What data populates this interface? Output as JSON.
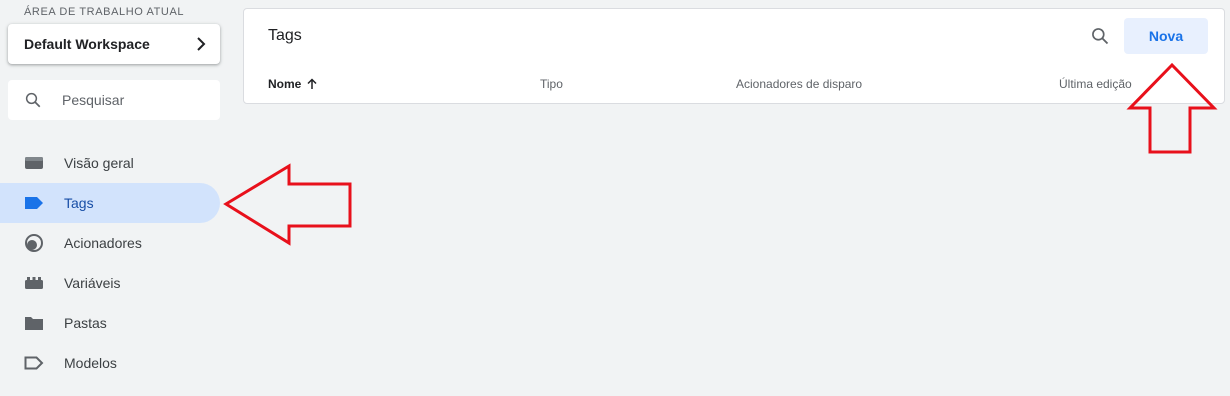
{
  "workspace": {
    "section_label": "ÁREA DE TRABALHO ATUAL",
    "name": "Default Workspace"
  },
  "sidebar": {
    "search_placeholder": "Pesquisar",
    "items": [
      {
        "label": "Visão geral",
        "icon": "overview-icon"
      },
      {
        "label": "Tags",
        "icon": "tag-icon",
        "active": true
      },
      {
        "label": "Acionadores",
        "icon": "trigger-icon"
      },
      {
        "label": "Variáveis",
        "icon": "variables-icon"
      },
      {
        "label": "Pastas",
        "icon": "folder-icon"
      },
      {
        "label": "Modelos",
        "icon": "template-icon"
      }
    ]
  },
  "main": {
    "title": "Tags",
    "new_button": "Nova",
    "columns": [
      {
        "label": "Nome",
        "sorted": "ascending"
      },
      {
        "label": "Tipo"
      },
      {
        "label": "Acionadores de disparo"
      },
      {
        "label": "Última edição"
      }
    ]
  },
  "colors": {
    "accent": "#1a73e8",
    "active_nav_bg": "#d2e3fc",
    "annotation_arrow": "#e8101b"
  }
}
